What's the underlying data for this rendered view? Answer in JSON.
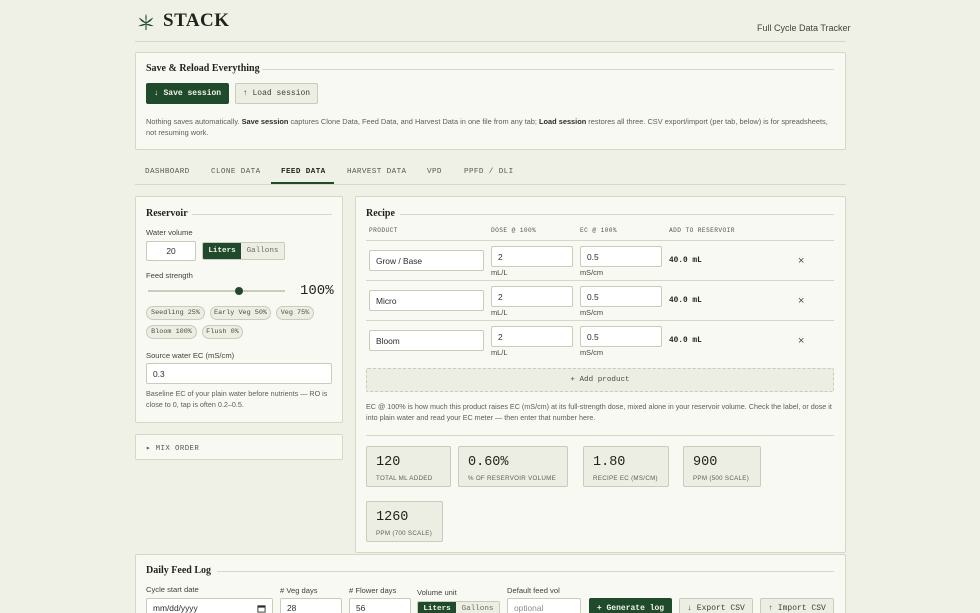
{
  "header": {
    "brand": "STACK",
    "tagline": "Full Cycle Data Tracker",
    "logo_icon": "cannabis-leaf-icon"
  },
  "session": {
    "title": "Save & Reload Everything",
    "save_label": "↓ Save session",
    "load_label": "↑ Load session",
    "note_prefix": "Nothing saves automatically. ",
    "note_save": "Save session",
    "note_mid": " captures Clone Data, Feed Data, and Harvest Data in one file from any tab; ",
    "note_load": "Load session",
    "note_suffix": " restores all three. CSV export/import (per tab, below) is for spreadsheets, not resuming work."
  },
  "tabs": [
    {
      "label": "DASHBOARD",
      "active": false
    },
    {
      "label": "CLONE DATA",
      "active": false
    },
    {
      "label": "FEED DATA",
      "active": true
    },
    {
      "label": "HARVEST DATA",
      "active": false
    },
    {
      "label": "VPD",
      "active": false
    },
    {
      "label": "PPFD / DLI",
      "active": false
    }
  ],
  "reservoir": {
    "title": "Reservoir",
    "water_volume_label": "Water volume",
    "water_volume_value": "20",
    "unit_options": [
      "Liters",
      "Gallons"
    ],
    "unit_selected": "Liters",
    "feed_strength_label": "Feed strength",
    "feed_strength_percent": 100,
    "feed_strength_display": "100%",
    "presets": [
      "Seedling 25%",
      "Early Veg 50%",
      "Veg 75%",
      "Bloom 100%",
      "Flush 0%"
    ],
    "source_ec_label": "Source water EC (mS/cm)",
    "source_ec_value": "0.3",
    "source_ec_help": "Baseline EC of your plain water before nutrients — RO is close to 0, tap is often 0.2–0.5."
  },
  "mix_order": {
    "label": "▸ MIX ORDER"
  },
  "recipe": {
    "title": "Recipe",
    "columns": [
      "PRODUCT",
      "DOSE @ 100%",
      "EC @ 100%",
      "ADD TO RESERVOIR"
    ],
    "rows": [
      {
        "product": "Grow / Base",
        "dose": "2",
        "dose_unit": "mL/L",
        "ec": "0.5",
        "ec_unit": "mS/cm",
        "add": "40.0 mL"
      },
      {
        "product": "Micro",
        "dose": "2",
        "dose_unit": "mL/L",
        "ec": "0.5",
        "ec_unit": "mS/cm",
        "add": "40.0 mL"
      },
      {
        "product": "Bloom",
        "dose": "2",
        "dose_unit": "mL/L",
        "ec": "0.5",
        "ec_unit": "mS/cm",
        "add": "40.0 mL"
      }
    ],
    "remove_glyph": "×",
    "add_product_label": "+ Add product",
    "help": "EC @ 100% is how much this product raises EC (mS/cm) at its full-strength dose, mixed alone in your reservoir volume. Check the label, or dose it into plain water and read your EC meter — then enter that number here.",
    "stats": [
      {
        "value": "120",
        "label": "TOTAL ML ADDED"
      },
      {
        "value": "0.60%",
        "label": "% OF RESERVOIR VOLUME"
      },
      {
        "value": "1.80",
        "label": "RECIPE EC (MS/CM)"
      },
      {
        "value": "900",
        "label": "PPM (500 SCALE)"
      },
      {
        "value": "1260",
        "label": "PPM (700 SCALE)"
      }
    ]
  },
  "feed_log": {
    "title": "Daily Feed Log",
    "cycle_start_label": "Cycle start date",
    "cycle_start_placeholder": "mm/dd/yyyy",
    "veg_days_label": "# Veg days",
    "veg_days_value": "28",
    "flower_days_label": "# Flower days",
    "flower_days_value": "56",
    "volume_unit_label": "Volume unit",
    "volume_unit_options": [
      "Liters",
      "Gallons"
    ],
    "default_vol_label": "Default feed vol",
    "default_vol_placeholder": "optional",
    "generate_label": "+ Generate log",
    "export_label": "↓ Export CSV",
    "import_label": "↑ Import CSV"
  }
}
